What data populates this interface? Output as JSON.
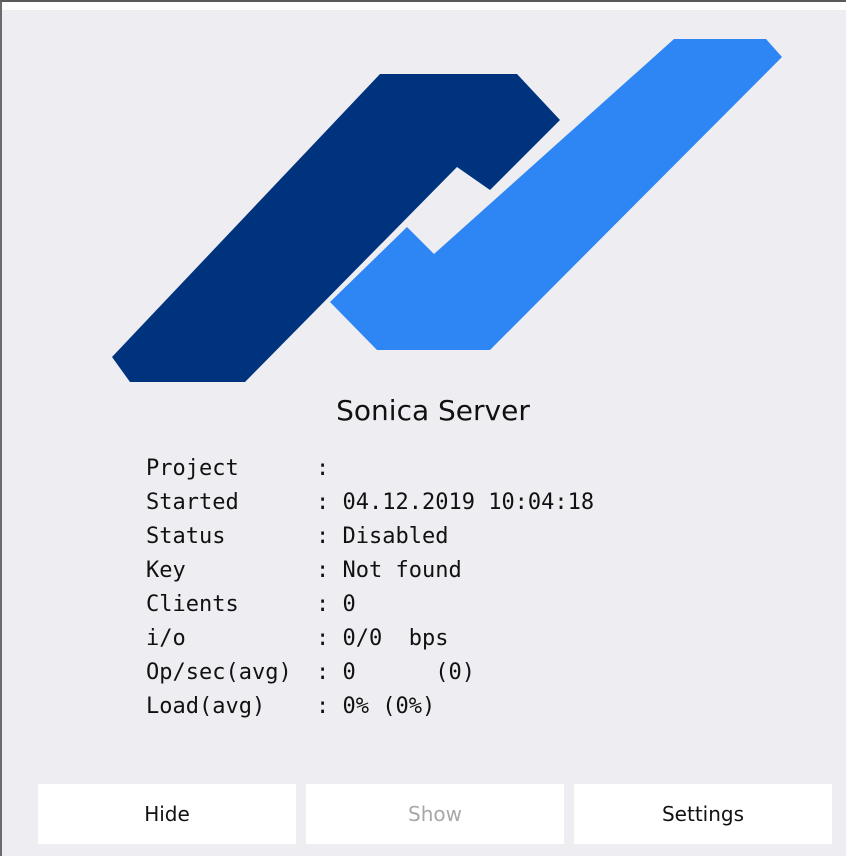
{
  "app": {
    "title": "Sonica Server",
    "logo_colors": {
      "dark": "#00337e",
      "light": "#2e86f5"
    }
  },
  "info": [
    {
      "key": "Project",
      "value": ""
    },
    {
      "key": "Started",
      "value": "04.12.2019 10:04:18"
    },
    {
      "key": "Status",
      "value": "Disabled"
    },
    {
      "key": "Key",
      "value": "Not found"
    },
    {
      "key": "Clients",
      "value": "0"
    },
    {
      "key": "i/o",
      "value": "0/0  bps"
    },
    {
      "key": "Op/sec(avg)",
      "value": "0      (0)"
    },
    {
      "key": "Load(avg)",
      "value": "0% (0%)"
    }
  ],
  "buttons": {
    "hide": "Hide",
    "show": "Show",
    "settings": "Settings"
  }
}
